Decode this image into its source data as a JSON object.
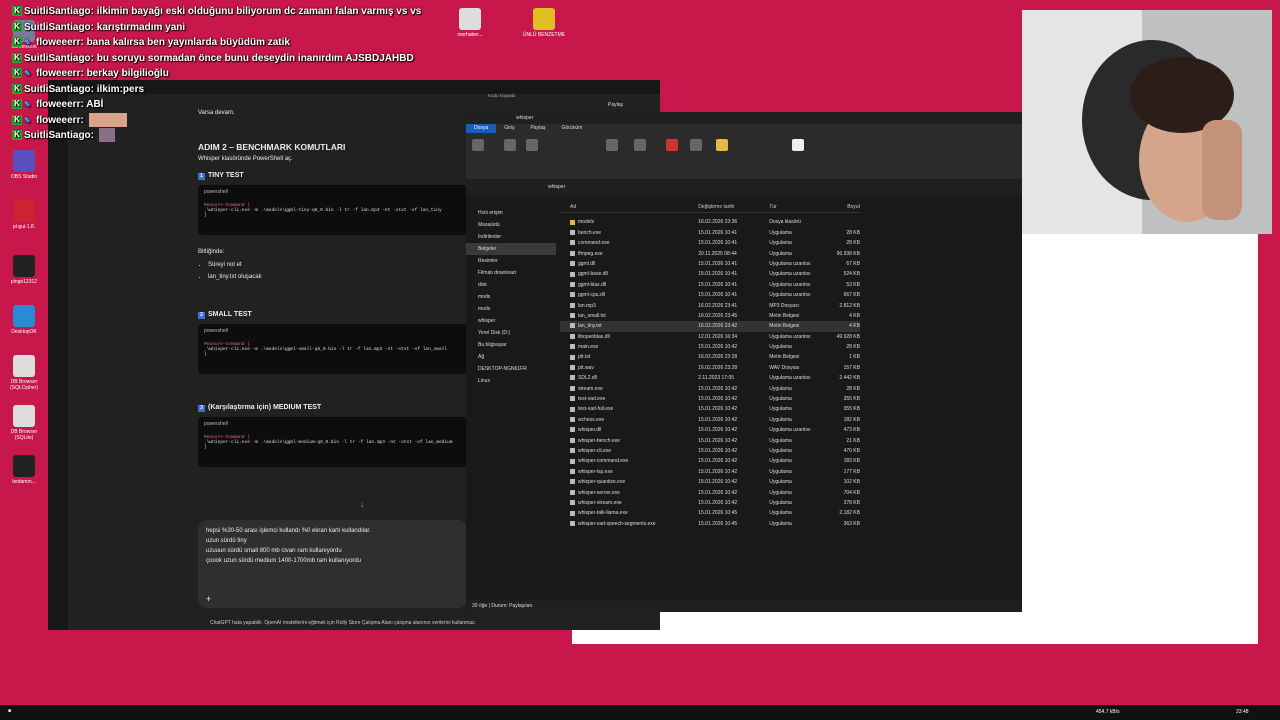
{
  "desktop_icons": [
    {
      "label": "Screenshot",
      "color": "#7a7a9a"
    },
    {
      "label": "OBS Studio",
      "color": "#5b4fbf"
    },
    {
      "label": "pl-gui-1.8.",
      "color": "#c23"
    },
    {
      "label": "pinge12312",
      "color": "#222"
    },
    {
      "label": "DesktopOK",
      "color": "#2a8ad6"
    },
    {
      "label": "DB Browser (SQLCipher)",
      "color": "#ddd"
    },
    {
      "label": "DB Browser (SQLite)",
      "color": "#ddd"
    },
    {
      "label": "bedamm...",
      "color": "#222"
    },
    {
      "label": "merhaber...",
      "color": "#ddd"
    },
    {
      "label": "ÜNLÜ BENZETME",
      "color": "#e0c020"
    }
  ],
  "chat": [
    {
      "user": "SuitliSantiago",
      "msg": "ilkimin bayağı eski olduğunu biliyorum dc zamanı falan varmış vs vs",
      "badge": "K"
    },
    {
      "user": "SuitliSantiago",
      "msg": "karıştırmadım yani",
      "badge": "K"
    },
    {
      "user": "floweeerr",
      "msg": "bana kalırsa ben yayınlarda büyüdüm zatik",
      "badge": "K"
    },
    {
      "user": "SuitliSantiago",
      "msg": "bu soruyu sormadan önce bunu deseydin inanırdım AJSBDJAHBD",
      "badge": "K"
    },
    {
      "user": "floweeerr",
      "msg": "berkay bilgilioğlu",
      "badge": "K"
    },
    {
      "user": "SuitliSantiago",
      "msg": "ilkim:pers",
      "badge": "K"
    },
    {
      "user": "floweeerr",
      "msg": "ABİ",
      "badge": "K"
    },
    {
      "user": "floweeerr",
      "msg": "",
      "badge": "K"
    },
    {
      "user": "SuitliSantiago",
      "msg": "",
      "badge": "K"
    }
  ],
  "gpt": {
    "top_text": "Varsa devam.",
    "step_title": "ADIM 2 – BENCHMARK KOMUTLARI",
    "step_sub": "Whisper klasöründe PowerShell aç.",
    "tiny": {
      "num": "1",
      "title": "TINY TEST",
      "lang": "powershell",
      "cmd1": "Measure-Command {",
      "cmd2": ".\\whisper-cli.exe -m .\\models\\ggml-tiny-q8_0.bin -l tr -f lan.mp3 -nt -otxt -of lan_tiny",
      "cmd3": "}"
    },
    "after_title": "Bittiğinde:",
    "after_items": [
      "Süreyi not et",
      "lan_tiny.txt oluşacak"
    ],
    "small": {
      "num": "2",
      "title": "SMALL TEST",
      "lang": "powershell",
      "cmd1": "Measure-Command {",
      "cmd2": ".\\whisper-cli.exe -m .\\models\\ggml-small-q8_0.bin -l tr -f lan.mp3 -nt -otxt -of lan_small",
      "cmd3": "}"
    },
    "medium": {
      "num": "3",
      "title": "(Karşılaştırma için) MEDIUM TEST",
      "lang": "powershell",
      "cmd1": "Measure-Command {",
      "cmd2": ".\\whisper-cli.exe -m .\\models\\ggml-medium-q8_0.bin -l tr -f lan.mp3 -nt -otxt -of lan_medium",
      "cmd3": "}"
    },
    "input_lines": [
      "hepsi %30-50 arası işlemci kullandı %0 ekran kartı kullandılar.",
      "uzun sürdü tiny",
      "uzuuun sürdü small 800 mb civarı ram kullanıyordu",
      "çoook uzun sürdü medium 1400-1700mb ram kullanıyordu"
    ],
    "footer": "ChatGPT hata yapabilir. OpenAI modellerini eğitmek için Rolly Store Çalışma Alanı çalışma alanının verilerini kullanmaz.",
    "share_label": "Paylaş",
    "copy_label": "Kodu kopyala"
  },
  "explorer": {
    "title": "whisper",
    "tabs": [
      "Dosya",
      "Giriş",
      "Paylaş",
      "Görünüm"
    ],
    "path": "whisper",
    "headers": [
      "Ad",
      "Değiştirme tarihi",
      "Tür",
      "Boyut"
    ],
    "nav": [
      "Hızlı erişim",
      "Masaüstü",
      "İndirilenler",
      "Belgeler",
      "Resimler",
      "Filmatı download",
      "disk",
      "mods",
      "mods",
      "whisper",
      "Yerel Disk (D:)",
      "Bu bilgisayar",
      "Ağ",
      "DESKTOP-NGN61FR",
      "Linux"
    ],
    "files": [
      [
        "models",
        "16.02.2026 23:36",
        "Dosya klasörü",
        "",
        "folder"
      ],
      [
        "bench.exe",
        "15.01.2026 10:41",
        "Uygulama",
        "28 KB",
        "file"
      ],
      [
        "command.exe",
        "15.01.2026 10:41",
        "Uygulama",
        "28 KB",
        "file"
      ],
      [
        "ffmpeg.exe",
        "20.11.2025 08:44",
        "Uygulama",
        "96.938 KB",
        "file"
      ],
      [
        "ggml.dll",
        "15.01.2026 10:41",
        "Uygulama uzantısı",
        "67 KB",
        "file"
      ],
      [
        "ggml-base.dll",
        "15.01.2026 10:41",
        "Uygulama uzantısı",
        "524 KB",
        "file"
      ],
      [
        "ggml-blas.dll",
        "15.01.2026 10:41",
        "Uygulama uzantısı",
        "53 KB",
        "file"
      ],
      [
        "ggml-cpu.dll",
        "15.01.2026 10:41",
        "Uygulama uzantısı",
        "667 KB",
        "file"
      ],
      [
        "lan.mp3",
        "16.02.2026 23:41",
        "MP3 Dosyası",
        "2.812 KB",
        "file"
      ],
      [
        "lan_small.txt",
        "16.02.2026 23:45",
        "Metin Belgesi",
        "4 KB",
        "file"
      ],
      [
        "lan_tiny.txt",
        "16.02.2026 23:42",
        "Metin Belgesi",
        "4 KB",
        "file"
      ],
      [
        "libopenblas.dll",
        "12.01.2026 16:34",
        "Uygulama uzantısı",
        "49.928 KB",
        "file"
      ],
      [
        "main.exe",
        "15.01.2026 10:42",
        "Uygulama",
        "28 KB",
        "file"
      ],
      [
        "ptt.txt",
        "16.02.2026 23:28",
        "Metin Belgesi",
        "1 KB",
        "file"
      ],
      [
        "ptt.wav",
        "16.02.2026 23:28",
        "WAV Dosyası",
        "157 KB",
        "file"
      ],
      [
        "SDL2.dll",
        "2.11.2023 17:05",
        "Uygulama uzantısı",
        "2.442 KB",
        "file"
      ],
      [
        "stream.exe",
        "15.01.2026 10:42",
        "Uygulama",
        "28 KB",
        "file"
      ],
      [
        "test-vad.exe",
        "15.01.2026 10:42",
        "Uygulama",
        "355 KB",
        "file"
      ],
      [
        "test-vad-full.exe",
        "15.01.2026 10:42",
        "Uygulama",
        "355 KB",
        "file"
      ],
      [
        "wchess.exe",
        "15.01.2026 10:42",
        "Uygulama",
        "182 KB",
        "file"
      ],
      [
        "whisper.dll",
        "15.01.2026 10:42",
        "Uygulama uzantısı",
        "473 KB",
        "file"
      ],
      [
        "whisper-bench.exe",
        "15.01.2026 10:42",
        "Uygulama",
        "21 KB",
        "file"
      ],
      [
        "whisper-cli.exe",
        "15.01.2026 10:42",
        "Uygulama",
        "470 KB",
        "file"
      ],
      [
        "whisper-command.exe",
        "15.01.2026 10:42",
        "Uygulama",
        "183 KB",
        "file"
      ],
      [
        "whisper-lsp.exe",
        "15.01.2026 10:42",
        "Uygulama",
        "177 KB",
        "file"
      ],
      [
        "whisper-quantize.exe",
        "15.01.2026 10:42",
        "Uygulama",
        "102 KB",
        "file"
      ],
      [
        "whisper-server.exe",
        "15.01.2026 10:42",
        "Uygulama",
        "704 KB",
        "file"
      ],
      [
        "whisper-stream.exe",
        "15.01.2026 10:42",
        "Uygulama",
        "378 KB",
        "file"
      ],
      [
        "whisper-talk-llama.exe",
        "15.01.2026 10:45",
        "Uygulama",
        "2.182 KB",
        "file"
      ],
      [
        "whisper-vad-speech-segments.exe",
        "15.01.2026 10:45",
        "Uygulama",
        "363 KB",
        "file"
      ]
    ],
    "status": "30 öğe | Durum: Paylaşılan"
  },
  "taskbar": {
    "time": "23:48",
    "net": "454.7 kB/s"
  }
}
